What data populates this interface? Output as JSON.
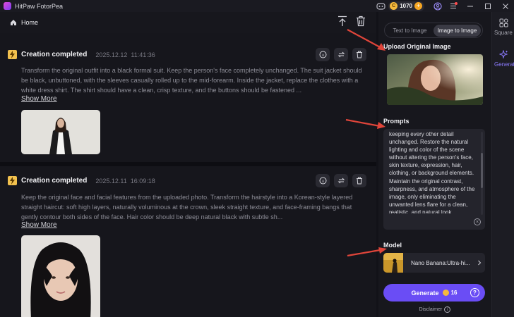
{
  "app": {
    "title": "HitPaw FotorPea"
  },
  "titlebar": {
    "coins": "1070",
    "coin_symbol": "C",
    "plus_symbol": "+"
  },
  "header": {
    "home_label": "Home"
  },
  "feed": {
    "items": [
      {
        "title": "Creation completed",
        "date": "2025.12.12",
        "time": "11:41:36",
        "text": "Transform the original outfit into a black formal suit. Keep the person's face completely unchanged. The suit jacket should be black, unbuttoned, with the sleeves casually rolled up to the mid-forearm. Inside the jacket, replace the clothes with a white dress shirt. The shirt should have a clean, crisp texture, and the buttons should be fastened ...",
        "show_more": "Show More"
      },
      {
        "title": "Creation completed",
        "date": "2025.12.11",
        "time": "16:09:18",
        "text": "Keep the original face and facial features from the uploaded photo. Transform the hairstyle into a Korean-style layered straight haircut: soft high layers, naturally voluminous at the crown, sleek straight texture, and face-framing bangs that gently contour both sides of the face. Hair color should be deep natural black with subtle sh...",
        "show_more": "Show More"
      }
    ]
  },
  "panel": {
    "tabs": [
      {
        "label": "Text to Image",
        "active": false
      },
      {
        "label": "Image to Image",
        "active": true
      }
    ],
    "upload_title": "Upload Original Image",
    "prompts_title": "Prompts",
    "prompt_text": "keeping every other detail unchanged. Restore the natural lighting and color of the scene without altering the person's face, skin texture, expression, hair, clothing, or background elements. Maintain the original contrast, sharpness, and atmosphere of the image, only eliminating the unwanted lens flare for a clean, realistic, and natural look.",
    "clear_symbol": "×",
    "model_title": "Model",
    "model_name": "Nano Banana:Ultra-hi...",
    "generate_label": "Generate",
    "generate_cost": "16",
    "help_symbol": "?",
    "disclaimer": "Disclaimer",
    "info_symbol": "i"
  },
  "rail": {
    "items": [
      {
        "label": "Square",
        "icon": "grid-icon",
        "active": false
      },
      {
        "label": "Generate",
        "icon": "sparkle-icon",
        "active": true
      }
    ]
  },
  "colors": {
    "accent": "#6a4df5",
    "annotation_arrow": "#e0453a",
    "coin": "#f5b93d"
  }
}
